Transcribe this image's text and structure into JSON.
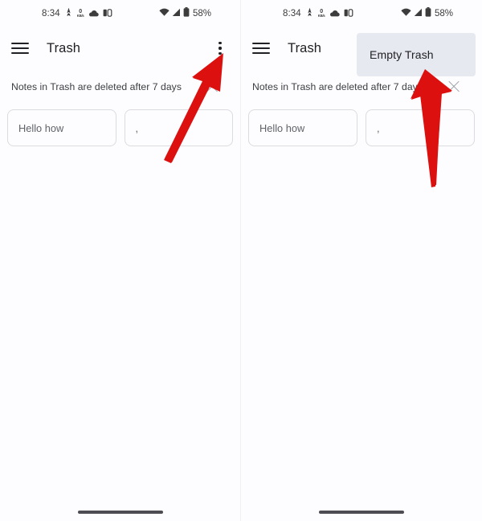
{
  "panels": [
    {
      "id": "panel-before",
      "status_bar": {
        "time": "8:34",
        "data_rate_value": "0",
        "data_rate_unit": "KB/s",
        "icons": [
          "walk-icon",
          "data-rate-icon",
          "cloud-icon",
          "contrast-icon",
          "wifi-icon",
          "signal-icon",
          "battery-icon"
        ],
        "battery_percent": "58%"
      },
      "app_bar": {
        "menu_icon": "hamburger-icon",
        "title": "Trash",
        "overflow_icon": "more-vert-icon"
      },
      "notice": {
        "text": "Notes in Trash are deleted after 7 days",
        "close_icon": "close-icon"
      },
      "notes": [
        {
          "text": "Hello how"
        },
        {
          "text": ","
        }
      ],
      "menu_open": false,
      "menu_items": []
    },
    {
      "id": "panel-after",
      "status_bar": {
        "time": "8:34",
        "data_rate_value": "0",
        "data_rate_unit": "KB/s",
        "icons": [
          "walk-icon",
          "data-rate-icon",
          "cloud-icon",
          "contrast-icon",
          "wifi-icon",
          "signal-icon",
          "battery-icon"
        ],
        "battery_percent": "58%"
      },
      "app_bar": {
        "menu_icon": "hamburger-icon",
        "title": "Trash",
        "overflow_icon": "more-vert-icon"
      },
      "notice": {
        "text": "Notes in Trash are deleted after 7 days",
        "close_icon": "close-icon"
      },
      "notes": [
        {
          "text": "Hello how"
        },
        {
          "text": ","
        }
      ],
      "menu_open": true,
      "menu_items": [
        {
          "label": "Empty Trash"
        }
      ]
    }
  ],
  "annotations": {
    "arrow_color": "#DD1010",
    "arrows": [
      {
        "name": "arrow-to-overflow-menu",
        "points_to": "more-vert-icon"
      },
      {
        "name": "arrow-to-empty-trash",
        "points_to": "Empty Trash"
      }
    ]
  },
  "colors": {
    "background": "#fdfcfe",
    "card_border": "#dadce0",
    "text_primary": "#202124",
    "text_secondary": "#5f6368",
    "menu_background": "#e6e9f0",
    "arrow_red": "#DD1010",
    "home_indicator": "#4c4c52"
  }
}
